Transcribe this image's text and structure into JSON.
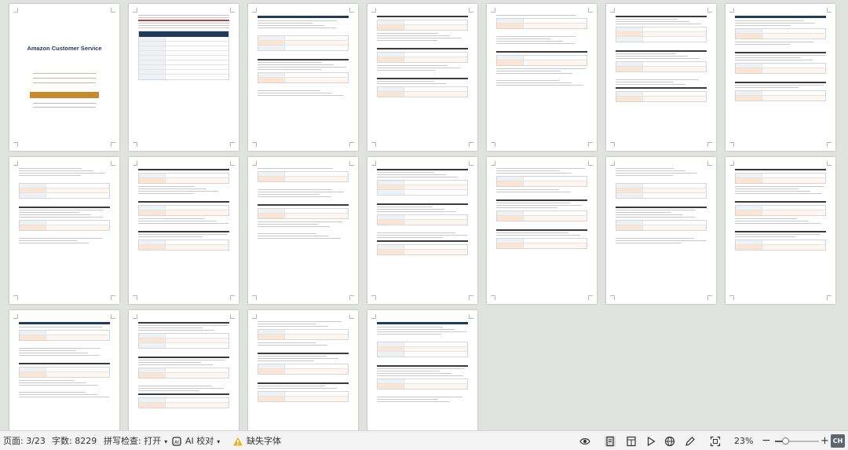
{
  "document": {
    "cover_title": "Amazon Customer Service",
    "page_count": 18
  },
  "statusbar": {
    "page_label": "页面: 3/23",
    "word_count_label": "字数: 8229",
    "spellcheck_label": "拼写检查: 打开",
    "ai_proofread_label": "AI 校对",
    "missing_font_label": "缺失字体",
    "zoom_label": "23%",
    "zoom_fraction": 0.23,
    "ime_label": "CH"
  },
  "colors": {
    "accent_navy": "#1f3a5a",
    "accent_orange": "#c98a2c",
    "accent_red": "#b84a3c"
  }
}
